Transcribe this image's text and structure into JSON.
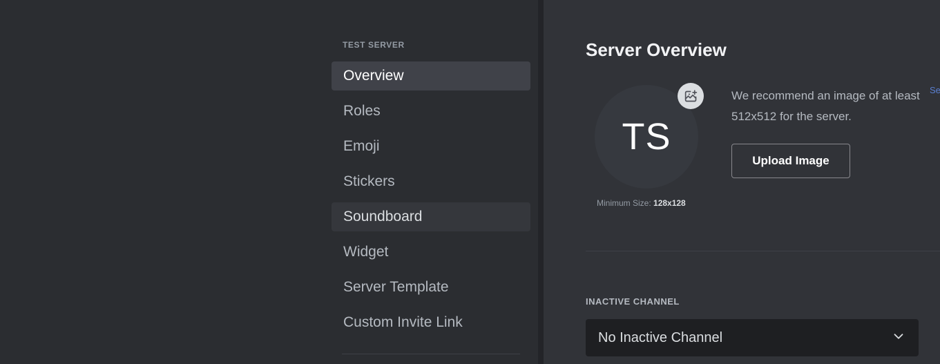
{
  "sidebar": {
    "header": "TEST SERVER",
    "items": [
      {
        "label": "Overview",
        "state": "active"
      },
      {
        "label": "Roles",
        "state": "normal"
      },
      {
        "label": "Emoji",
        "state": "normal"
      },
      {
        "label": "Stickers",
        "state": "normal"
      },
      {
        "label": "Soundboard",
        "state": "hover"
      },
      {
        "label": "Widget",
        "state": "normal"
      },
      {
        "label": "Server Template",
        "state": "normal"
      },
      {
        "label": "Custom Invite Link",
        "state": "normal"
      }
    ]
  },
  "content": {
    "title": "Server Overview",
    "avatar": {
      "initials": "TS",
      "badge_icon": "add-image-icon"
    },
    "min_size_prefix": "Minimum Size: ",
    "min_size_value": "128x128",
    "recommend_text": "We recommend an image of at least 512x512 for the server.",
    "upload_button": "Upload Image",
    "inactive_channel": {
      "label": "INACTIVE CHANNEL",
      "value": "No Inactive Channel",
      "chevron_icon": "chevron-down-icon"
    },
    "edge_clipped_text": "Se"
  },
  "colors": {
    "sidebar_bg": "#2b2d31",
    "content_bg": "#313338",
    "active_item": "#404249",
    "hover_item": "#35373c",
    "select_bg": "#1e1f22",
    "text_muted": "#949ba4",
    "text_normal": "#b5bac1",
    "text_bright": "#f2f3f5"
  }
}
